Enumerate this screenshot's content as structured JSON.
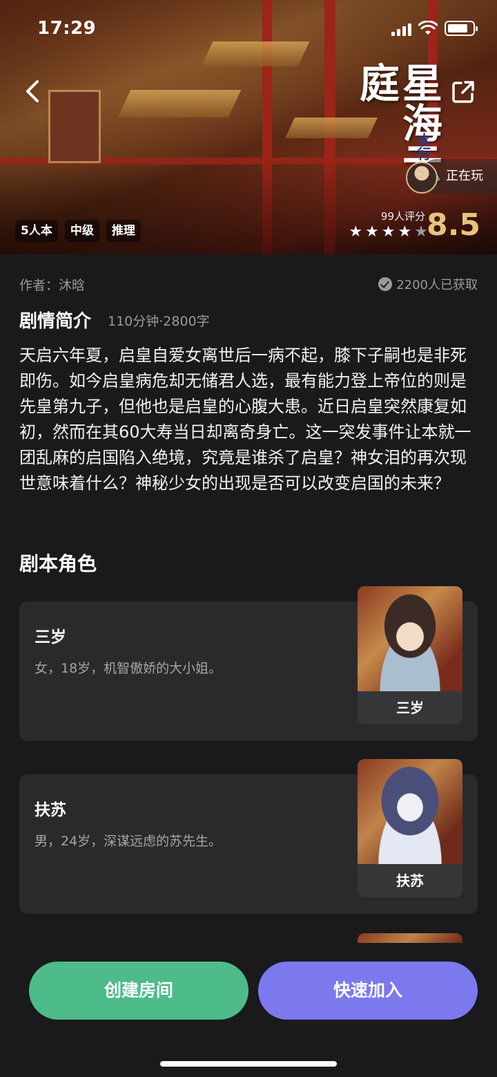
{
  "status_bar": {
    "time": "17:29"
  },
  "hero": {
    "title_art": "星海云庭",
    "title_sub": "水行",
    "playing_label": "正在玩",
    "tags": [
      "5人本",
      "中级",
      "推理"
    ],
    "rating_count": "99人评分",
    "stars": [
      1,
      1,
      1,
      1,
      0
    ],
    "score": "8.5",
    "accent_color": "#e8c47a"
  },
  "meta": {
    "author": "作者：沐晗",
    "obtained": "2200人已获取"
  },
  "synopsis": {
    "title": "剧情简介",
    "meta": "110分钟·2800字",
    "text": "天启六年夏，启皇自爱女离世后一病不起，膝下子嗣也是非死即伤。如今启皇病危却无储君人选，最有能力登上帝位的则是先皇第九子，但他也是启皇的心腹大患。近日启皇突然康复如初，然而在其60大寿当日却离奇身亡。这一突发事件让本就一团乱麻的启国陷入绝境，究竟是谁杀了启皇？神女泪的再次现世意味着什么？神秘少女的出现是否可以改变启国的未来？"
  },
  "roles": {
    "title": "剧本角色",
    "items": [
      {
        "name": "三岁",
        "desc": "女，18岁，机智傲娇的大小姐。",
        "portrait_label": "三岁"
      },
      {
        "name": "扶苏",
        "desc": "男，24岁，深谋远虑的苏先生。",
        "portrait_label": "扶苏"
      }
    ]
  },
  "actions": {
    "create": "创建房间",
    "join": "快速加入",
    "create_color": "#4dbb8a",
    "join_color": "#7c79ee"
  }
}
